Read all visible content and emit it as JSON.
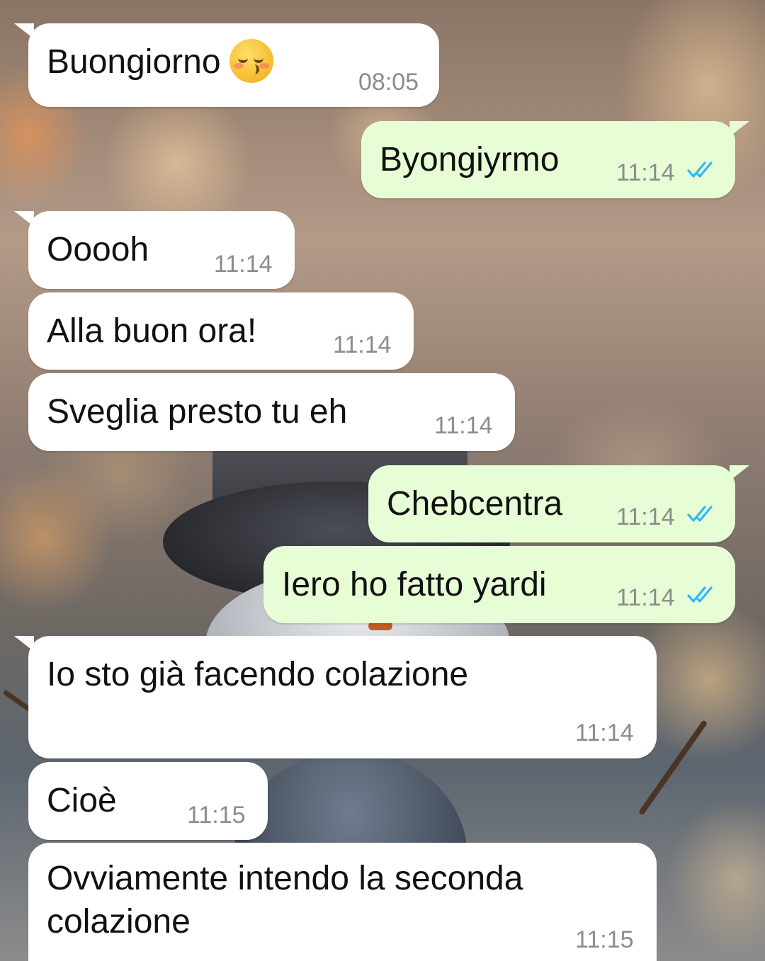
{
  "conversation": {
    "messages": [
      {
        "direction": "incoming",
        "text": "Buongiorno",
        "emoji": "kissing-face-closed-eyes-emoji",
        "time": "08:05"
      },
      {
        "direction": "outgoing",
        "text": "Byongiyrmo",
        "time": "11:14",
        "status": "read"
      },
      {
        "direction": "incoming",
        "text": "Ooooh",
        "time": "11:14"
      },
      {
        "direction": "incoming",
        "text": "Alla buon ora!",
        "time": "11:14"
      },
      {
        "direction": "incoming",
        "text": "Sveglia presto tu eh",
        "time": "11:14"
      },
      {
        "direction": "outgoing",
        "text": "Chebcentra",
        "time": "11:14",
        "status": "read"
      },
      {
        "direction": "outgoing",
        "text": "Iero ho fatto yardi",
        "time": "11:14",
        "status": "read"
      },
      {
        "direction": "incoming",
        "text": "Io sto già facendo colazione",
        "time": "11:14"
      },
      {
        "direction": "incoming",
        "text": "Cioè",
        "time": "11:15"
      },
      {
        "direction": "incoming",
        "text_lines": [
          "Ovviamente intendo la seconda",
          "colazione"
        ],
        "time": "11:15"
      }
    ]
  },
  "colors": {
    "incoming_bubble": "#ffffff",
    "outgoing_bubble": "#e7fdd6",
    "read_ticks": "#34b7f1",
    "timestamp": "#8c8c8c"
  }
}
